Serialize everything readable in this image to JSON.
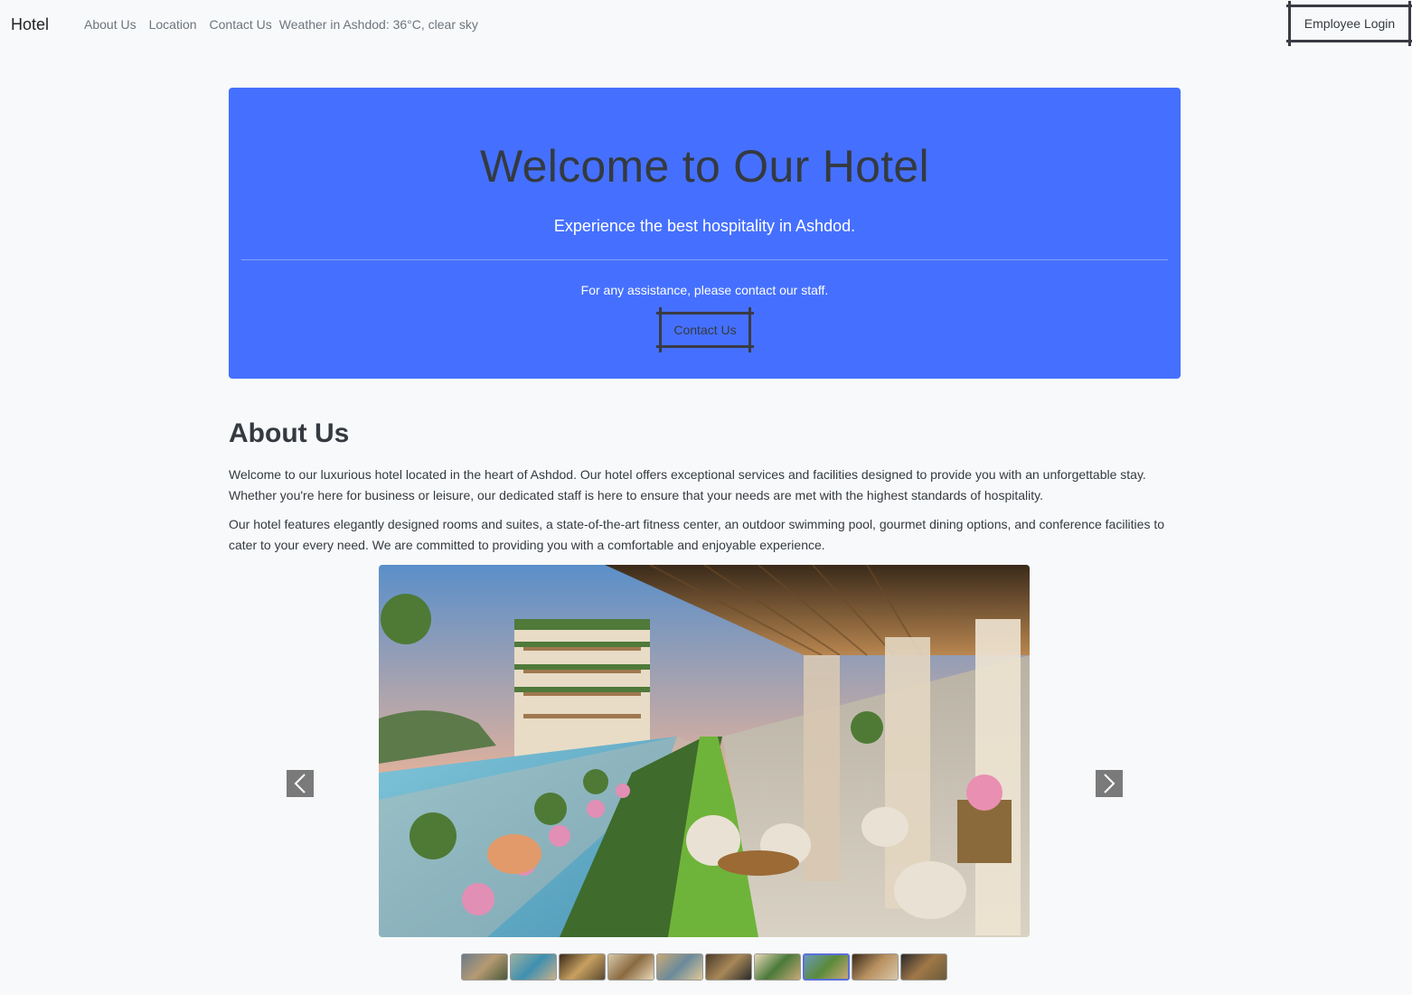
{
  "navbar": {
    "brand": "Hotel",
    "links": [
      "About Us",
      "Location",
      "Contact Us"
    ],
    "weather": "Weather in Ashdod: 36°C, clear sky",
    "login_label": "Employee Login"
  },
  "hero": {
    "title": "Welcome to Our Hotel",
    "lead": "Experience the best hospitality in Ashdod.",
    "note": "For any assistance, please contact our staff.",
    "button_label": "Contact Us",
    "background_color": "#4570ff"
  },
  "about": {
    "title": "About Us",
    "paragraphs": [
      "Welcome to our luxurious hotel located in the heart of Ashdod. Our hotel offers exceptional services and facilities designed to provide you with an unforgettable stay. Whether you're here for business or leisure, our dedicated staff is here to ensure that your needs are met with the highest standards of hospitality.",
      "Our hotel features elegantly designed rooms and suites, a state-of-the-art fitness center, an outdoor swimming pool, gourmet dining options, and conference facilities to cater to your every need. We are committed to providing you with a comfortable and enjoyable experience."
    ]
  },
  "carousel": {
    "prev_icon": "chevron-left-icon",
    "next_icon": "chevron-right-icon",
    "thumbnail_count": 10,
    "active_index": 8
  }
}
